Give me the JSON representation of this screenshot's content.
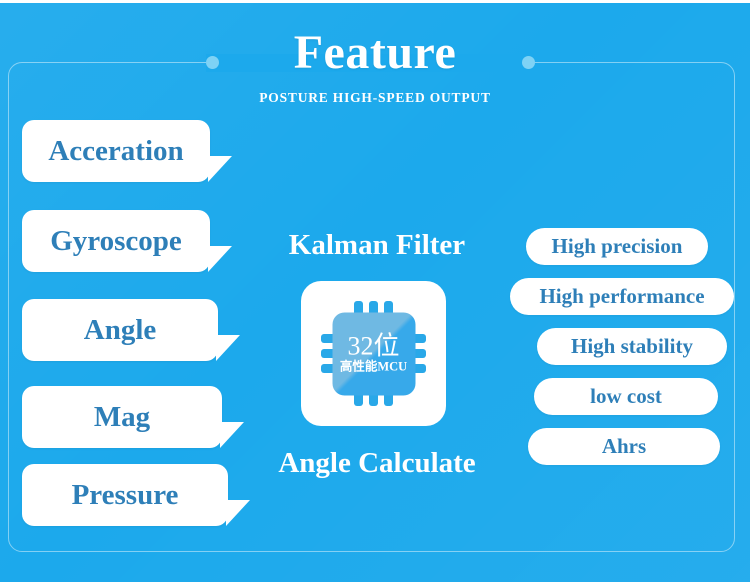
{
  "header": {
    "title": "Feature",
    "subtitle": "POSTURE HIGH-SPEED OUTPUT"
  },
  "colors": {
    "background": "#1CA9EC",
    "card": "#ffffff",
    "label_text": "#2E7FB8",
    "frame_dot": "#7ED2F5",
    "chip_pin": "#29A8E8",
    "chip_die_light": "#6FB9E3",
    "chip_die_dark": "#37A9EA"
  },
  "sensors": [
    {
      "label": "Acceration"
    },
    {
      "label": "Gyroscope"
    },
    {
      "label": "Angle"
    },
    {
      "label": "Mag"
    },
    {
      "label": "Pressure"
    }
  ],
  "center": {
    "caption_top": "Kalman Filter",
    "caption_bottom": "Angle Calculate",
    "chip": {
      "line_main": "32位",
      "line_sub": "高性能MCU"
    }
  },
  "benefits": [
    {
      "label": "High precision"
    },
    {
      "label": "High performance"
    },
    {
      "label": "High stability"
    },
    {
      "label": "low cost"
    },
    {
      "label": "Ahrs"
    }
  ]
}
